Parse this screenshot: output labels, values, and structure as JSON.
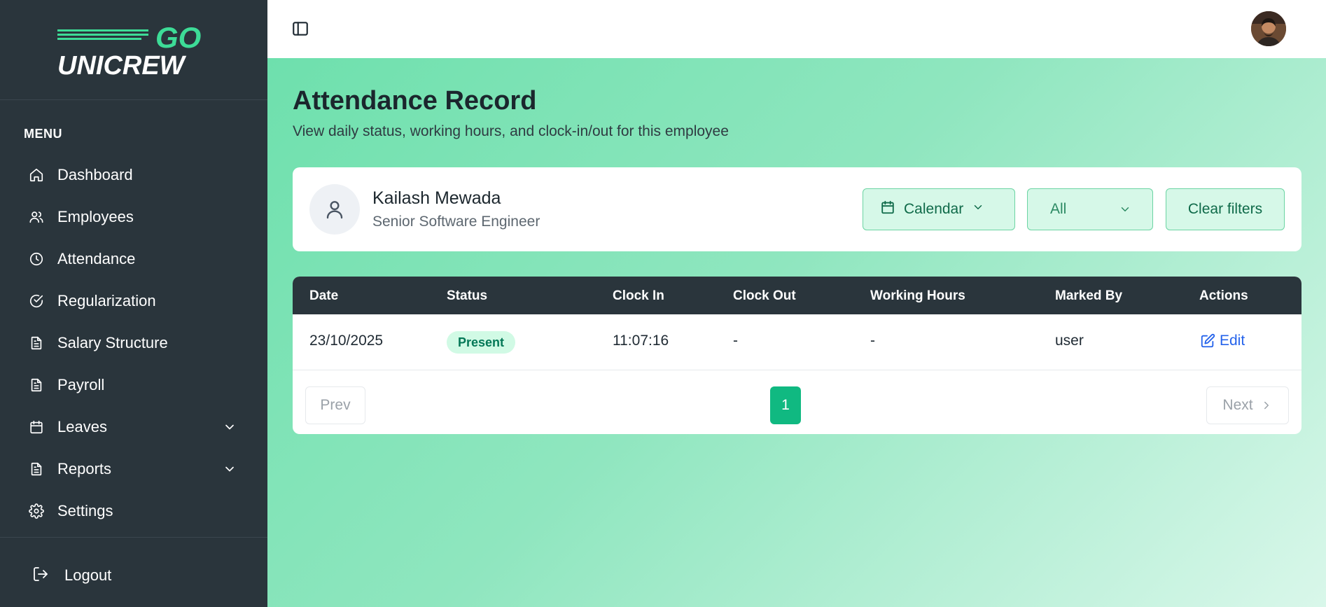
{
  "brand": {
    "logo_top": "GO",
    "logo_bottom": "UNICREW",
    "accent": "#3ddc97"
  },
  "sidebar": {
    "menu_heading": "MENU",
    "items": [
      {
        "label": "Dashboard",
        "icon": "home-icon"
      },
      {
        "label": "Employees",
        "icon": "users-icon"
      },
      {
        "label": "Attendance",
        "icon": "clock-icon"
      },
      {
        "label": "Regularization",
        "icon": "check-circle-icon"
      },
      {
        "label": "Salary Structure",
        "icon": "document-icon"
      },
      {
        "label": "Payroll",
        "icon": "document-icon"
      },
      {
        "label": "Leaves",
        "icon": "calendar-icon",
        "expandable": true
      },
      {
        "label": "Reports",
        "icon": "document-icon",
        "expandable": true
      },
      {
        "label": "Settings",
        "icon": "gear-icon"
      }
    ],
    "logout_label": "Logout"
  },
  "header": {
    "toggle_icon": "sidebar-toggle-icon",
    "avatar_icon": "user-avatar"
  },
  "page": {
    "title": "Attendance Record",
    "subtitle": "View daily status, working hours, and clock-in/out for this employee"
  },
  "employee": {
    "name": "Kailash Mewada",
    "role": "Senior Software Engineer"
  },
  "filters": {
    "calendar_label": "Calendar",
    "status_value": "All",
    "clear_label": "Clear filters"
  },
  "table": {
    "columns": [
      "Date",
      "Status",
      "Clock In",
      "Clock Out",
      "Working Hours",
      "Marked By",
      "Actions"
    ],
    "rows": [
      {
        "date": "23/10/2025",
        "status": "Present",
        "clock_in": "11:07:16",
        "clock_out": "-",
        "working_hours": "-",
        "marked_by": "user",
        "action": "Edit"
      }
    ]
  },
  "pagination": {
    "prev_label": "Prev",
    "current_page": "1",
    "next_label": "Next"
  },
  "colors": {
    "sidebar_bg": "#2a353c",
    "status_present_bg": "#d1fae5",
    "status_present_text": "#047857",
    "link_blue": "#2563eb",
    "page_active": "#10b981"
  }
}
